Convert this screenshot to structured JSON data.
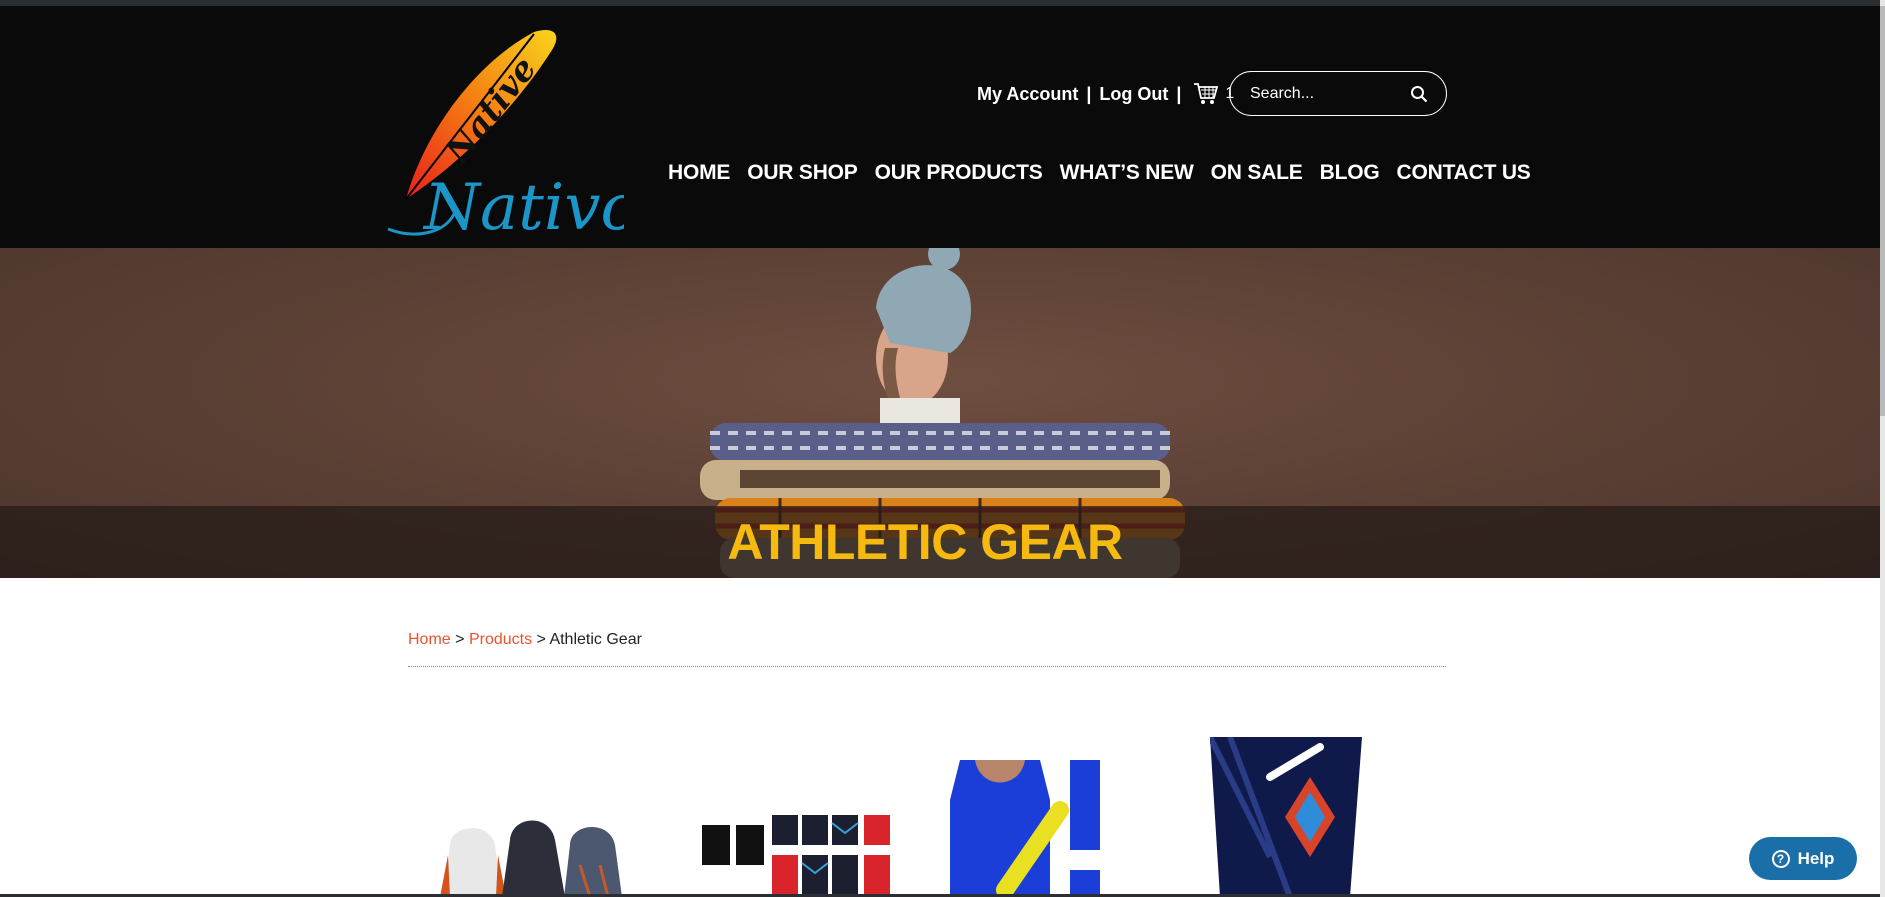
{
  "brand": {
    "logo_text_top": "Native",
    "logo_text_bottom": "Nativo"
  },
  "account": {
    "my_account": "My Account",
    "separator": "|",
    "log_out": "Log Out",
    "cart_count": "1"
  },
  "search": {
    "placeholder": "Search..."
  },
  "nav": [
    "HOME",
    "OUR SHOP",
    "OUR PRODUCTS",
    "WHAT’S NEW",
    "ON SALE",
    "BLOG",
    "CONTACT US"
  ],
  "hero": {
    "title": "ATHLETIC GEAR"
  },
  "breadcrumb": {
    "home": "Home",
    "products": "Products",
    "sep": ">",
    "current": "Athletic Gear"
  },
  "help": {
    "label": "Help",
    "icon": "?"
  },
  "colors": {
    "accent": "#f5b90f",
    "link": "#e8542e",
    "help": "#1a6fa8",
    "header": "#0a0a0a"
  }
}
